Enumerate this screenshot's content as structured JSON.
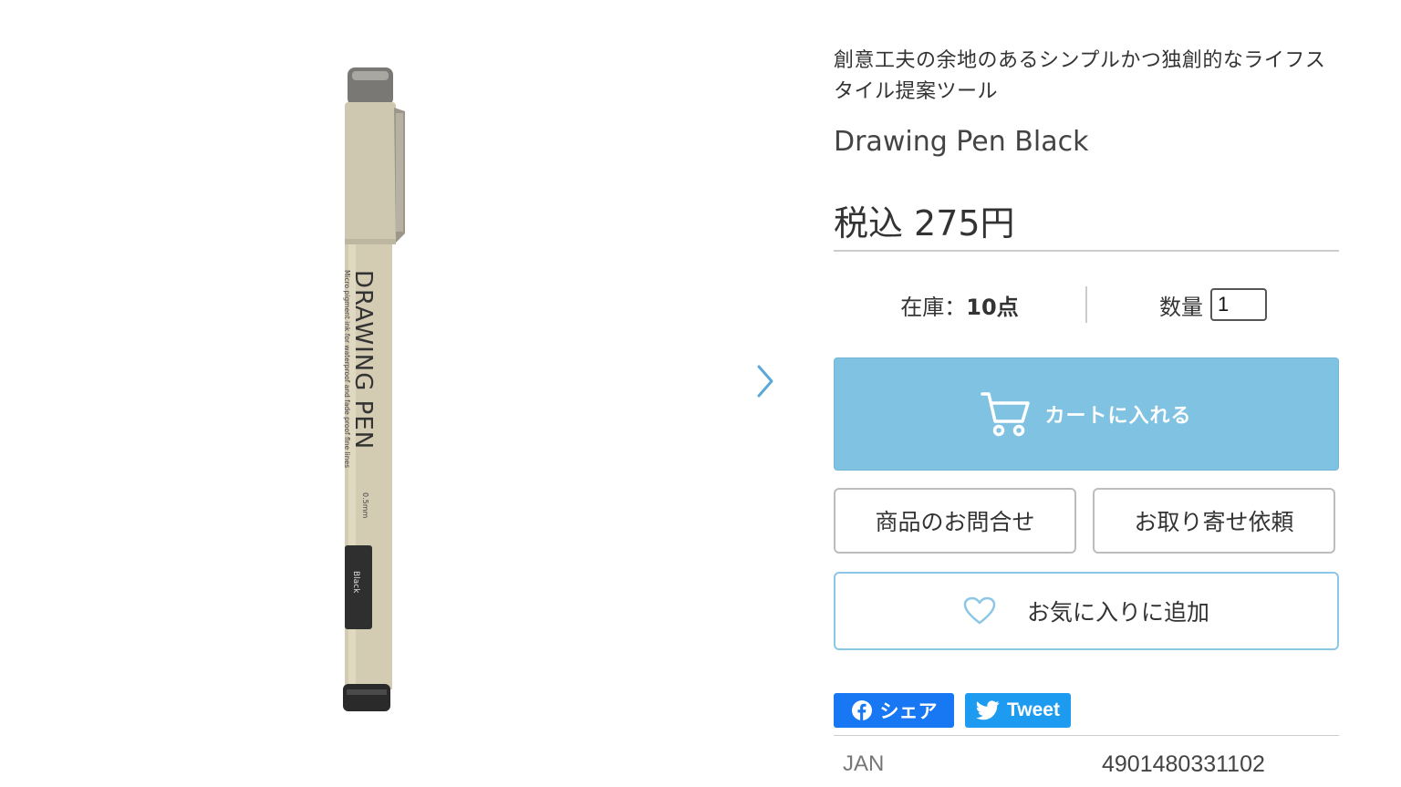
{
  "product_image": {
    "pen_title": "DRAWING PEN",
    "pen_size": "0.5mm",
    "pen_subtitle": "Micro pigment ink for waterproof and fade proof fine lines",
    "pen_color_label": "Black"
  },
  "product": {
    "catch_copy_line1": "創意工夫の余地のあるシンプルかつ独創的なライフス",
    "catch_copy_line2": "タイル提案ツール",
    "name": "Drawing Pen Black",
    "price_tax_label": "税込",
    "price": "275円"
  },
  "stock": {
    "label": "在庫：",
    "value": "10点"
  },
  "quantity": {
    "label": "数量",
    "value": "1"
  },
  "buttons": {
    "cart": "カートに入れる",
    "inquiry": "商品のお問合せ",
    "order_request": "お取り寄せ依頼",
    "favorite": "お気に入りに追加"
  },
  "share": {
    "facebook": "シェア",
    "twitter": "Tweet"
  },
  "jan": {
    "label": "JAN",
    "value": "4901480331102"
  },
  "colors": {
    "cart_button": "#80c2e2",
    "favorite_border": "#8cc7e6",
    "facebook": "#1877f2",
    "twitter": "#1d9bf0"
  },
  "icons": [
    "chevron-right-icon",
    "cart-icon",
    "heart-icon",
    "facebook-icon",
    "twitter-icon"
  ]
}
